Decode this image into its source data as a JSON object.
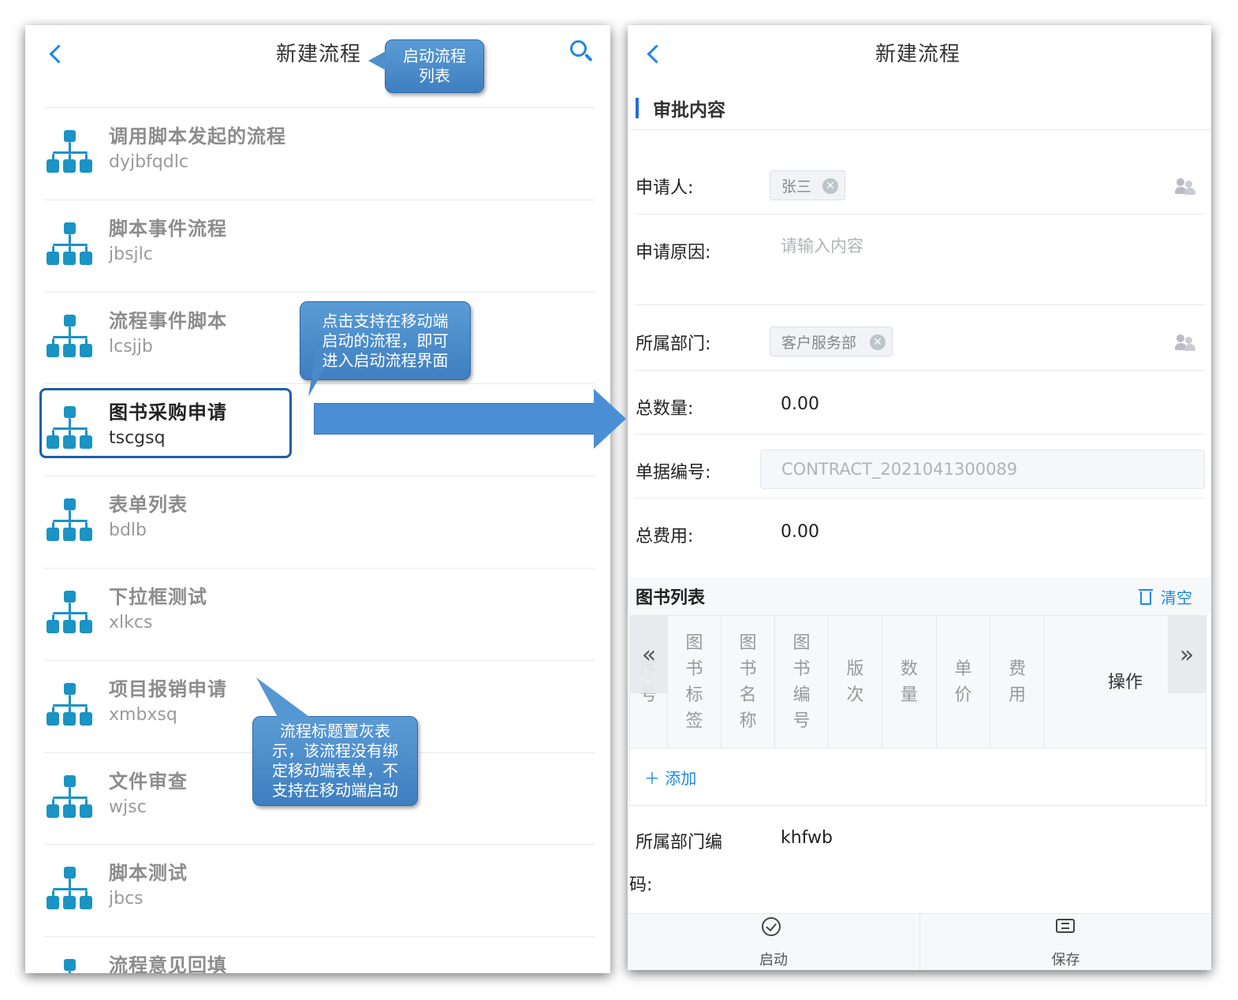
{
  "left": {
    "nav_title": "新建流程",
    "flows": [
      {
        "name": "调用脚本发起的流程",
        "code": "dyjbfqdlc"
      },
      {
        "name": "脚本事件流程",
        "code": "jbsjlc"
      },
      {
        "name": "流程事件脚本",
        "code": "lcsjjb"
      },
      {
        "name": "图书采购申请",
        "code": "tscgsq"
      },
      {
        "name": "表单列表",
        "code": "bdlb"
      },
      {
        "name": "下拉框测试",
        "code": "xlkcs"
      },
      {
        "name": "项目报销申请",
        "code": "xmbxsq"
      },
      {
        "name": "文件审查",
        "code": "wjsc"
      },
      {
        "name": "脚本测试",
        "code": "jbcs"
      },
      {
        "name": "流程意见回填",
        "code": ""
      }
    ]
  },
  "callouts": {
    "list_title": "启动流程列表",
    "click_hint": "点击支持在移动端启动的流程，即可进入启动流程界面",
    "grey_hint": "流程标题置灰表示，该流程没有绑定移动端表单，不支持在移动端启动"
  },
  "right": {
    "nav_title": "新建流程",
    "section_title": "审批内容",
    "fields": {
      "applicant_label": "申请人:",
      "applicant_tag": "张三",
      "reason_label": "申请原因:",
      "reason_placeholder": "请输入内容",
      "dept_label": "所属部门:",
      "dept_tag": "客户服务部",
      "total_qty_label": "总数量:",
      "total_qty_value": "0.00",
      "doc_no_label": "单据编号:",
      "doc_no_value": "CONTRACT_2021041300089",
      "total_cost_label": "总费用:",
      "total_cost_value": "0.00",
      "dept_code_label_1": "所属部门编",
      "dept_code_label_2": "码:",
      "dept_code_value": "khfwb"
    },
    "book_list": {
      "title": "图书列表",
      "clear_label": "清空",
      "columns": [
        "序号",
        "图书标签",
        "图书名称",
        "图书编号",
        "版次",
        "数量",
        "单价",
        "费用"
      ],
      "op_label": "操作",
      "add_label": "＋ 添加"
    },
    "footer": {
      "start_label": "启动",
      "save_label": "保存"
    }
  },
  "colors": {
    "accent": "#1e88e5",
    "flow_icon": "#1a93c5",
    "callout": "#4f8fcb",
    "highlight_border": "#1d5fa6"
  }
}
